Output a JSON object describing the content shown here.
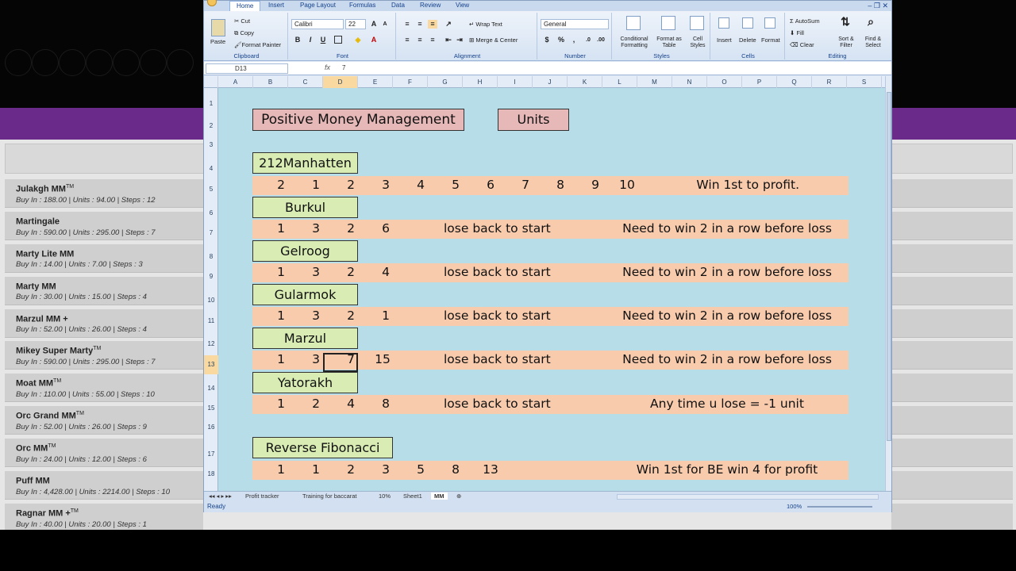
{
  "background": {
    "items": [
      {
        "name": "Julakgh MM",
        "tm": "TM",
        "detail": "Buy In : 188.00 | Units : 94.00 | Steps : 12"
      },
      {
        "name": "Martingale",
        "tm": "",
        "detail": "Buy In : 590.00 | Units : 295.00 | Steps : 7"
      },
      {
        "name": "Marty Lite MM",
        "tm": "",
        "detail": "Buy In : 14.00 | Units : 7.00 | Steps : 3"
      },
      {
        "name": "Marty MM",
        "tm": "",
        "detail": "Buy In : 30.00 | Units : 15.00 | Steps : 4"
      },
      {
        "name": "Marzul MM +",
        "tm": "",
        "detail": "Buy In : 52.00 | Units : 26.00 | Steps : 4"
      },
      {
        "name": "Mikey Super Marty",
        "tm": "TM",
        "detail": "Buy In : 590.00 | Units : 295.00 | Steps : 7"
      },
      {
        "name": "Moat MM",
        "tm": "TM",
        "detail": "Buy In : 110.00 | Units : 55.00 | Steps : 10"
      },
      {
        "name": "Orc Grand MM",
        "tm": "TM",
        "detail": "Buy In : 52.00 | Units : 26.00 | Steps : 9"
      },
      {
        "name": "Orc MM",
        "tm": "TM",
        "detail": "Buy In : 24.00 | Units : 12.00 | Steps : 6"
      },
      {
        "name": "Puff MM",
        "tm": "",
        "detail": "Buy In : 4,428.00 | Units : 2214.00 | Steps : 10"
      },
      {
        "name": "Ragnar MM +",
        "tm": "TM",
        "detail": "Buy In : 40.00 | Units : 20.00 | Steps : 1"
      }
    ]
  },
  "excel": {
    "ribbon_tabs": [
      "Home",
      "Insert",
      "Page Layout",
      "Formulas",
      "Data",
      "Review",
      "View"
    ],
    "clipboard": {
      "paste": "Paste",
      "cut": "Cut",
      "copy": "Copy",
      "format_painter": "Format Painter",
      "label": "Clipboard"
    },
    "font": {
      "name": "Calibri",
      "size": "22",
      "label": "Font",
      "bold": "B",
      "italic": "I",
      "underline": "U"
    },
    "alignment": {
      "wrap": "Wrap Text",
      "merge": "Merge & Center",
      "label": "Alignment"
    },
    "number": {
      "format": "General",
      "label": "Number"
    },
    "styles": {
      "conditional": "Conditional Formatting",
      "table": "Format as Table",
      "cell": "Cell Styles",
      "label": "Styles"
    },
    "cells": {
      "insert": "Insert",
      "delete": "Delete",
      "format": "Format",
      "label": "Cells"
    },
    "editing": {
      "autosum": "AutoSum",
      "fill": "Fill",
      "clear": "Clear",
      "sort": "Sort & Filter",
      "find": "Find & Select",
      "label": "Editing"
    },
    "formula_bar": {
      "cell_ref": "D13",
      "fx": "fx",
      "content": "7"
    },
    "columns": [
      "A",
      "B",
      "C",
      "D",
      "E",
      "F",
      "G",
      "H",
      "I",
      "J",
      "K",
      "L",
      "M",
      "N",
      "O",
      "P",
      "Q",
      "R",
      "S"
    ],
    "selected_column": "D",
    "rows": [
      "1",
      "2",
      "3",
      "4",
      "5",
      "6",
      "7",
      "8",
      "9",
      "10",
      "11",
      "12",
      "13",
      "14",
      "15",
      "16",
      "17",
      "18"
    ],
    "selected_row": "13",
    "sheet": {
      "title": "Positive Money Management",
      "units": "Units",
      "systems": [
        {
          "name": "212Manhatten",
          "values": [
            "2",
            "1",
            "2",
            "3",
            "4",
            "5",
            "6",
            "7",
            "8",
            "9",
            "10"
          ],
          "mid": "",
          "note": "Win 1st to profit."
        },
        {
          "name": "Burkul",
          "values": [
            "1",
            "3",
            "2",
            "6"
          ],
          "mid": "lose back to start",
          "note": "Need to win 2 in a row before loss"
        },
        {
          "name": "Gelroog",
          "values": [
            "1",
            "3",
            "2",
            "4"
          ],
          "mid": "lose back to start",
          "note": "Need to win 2 in a row before loss"
        },
        {
          "name": "Gularmok",
          "values": [
            "1",
            "3",
            "2",
            "1"
          ],
          "mid": "lose back to start",
          "note": "Need to win 2 in a row before loss"
        },
        {
          "name": "Marzul",
          "values": [
            "1",
            "3",
            "7",
            "15"
          ],
          "mid": "lose back to start",
          "note": "Need to win 2 in a row before loss"
        },
        {
          "name": "Yatorakh",
          "values": [
            "1",
            "2",
            "4",
            "8"
          ],
          "mid": "lose back to start",
          "note": "Any time u lose = -1 unit"
        },
        {
          "name": "Reverse Fibonacci",
          "values": [
            "1",
            "1",
            "2",
            "3",
            "5",
            "8",
            "13"
          ],
          "mid": "",
          "note": "Win 1st for BE win 4 for profit"
        }
      ]
    },
    "sheet_tabs": [
      "Profit tracker",
      "Training for baccarat",
      "10%",
      "Sheet1",
      "MM"
    ],
    "active_sheet": "MM",
    "status": "Ready",
    "zoom": "100%"
  }
}
